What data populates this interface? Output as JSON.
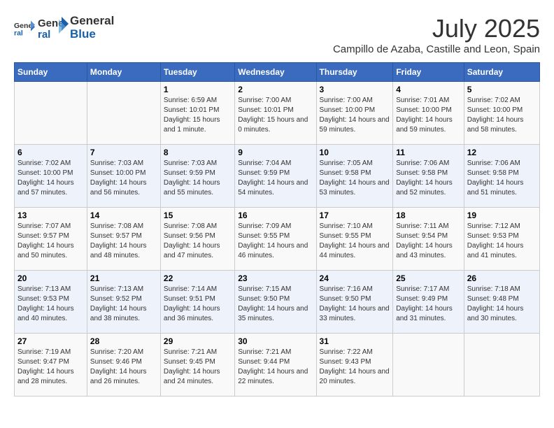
{
  "header": {
    "logo_line1": "General",
    "logo_line2": "Blue",
    "month_year": "July 2025",
    "location": "Campillo de Azaba, Castille and Leon, Spain"
  },
  "weekdays": [
    "Sunday",
    "Monday",
    "Tuesday",
    "Wednesday",
    "Thursday",
    "Friday",
    "Saturday"
  ],
  "weeks": [
    [
      {
        "day": "",
        "sunrise": "",
        "sunset": "",
        "daylight": ""
      },
      {
        "day": "",
        "sunrise": "",
        "sunset": "",
        "daylight": ""
      },
      {
        "day": "1",
        "sunrise": "Sunrise: 6:59 AM",
        "sunset": "Sunset: 10:01 PM",
        "daylight": "Daylight: 15 hours and 1 minute."
      },
      {
        "day": "2",
        "sunrise": "Sunrise: 7:00 AM",
        "sunset": "Sunset: 10:01 PM",
        "daylight": "Daylight: 15 hours and 0 minutes."
      },
      {
        "day": "3",
        "sunrise": "Sunrise: 7:00 AM",
        "sunset": "Sunset: 10:00 PM",
        "daylight": "Daylight: 14 hours and 59 minutes."
      },
      {
        "day": "4",
        "sunrise": "Sunrise: 7:01 AM",
        "sunset": "Sunset: 10:00 PM",
        "daylight": "Daylight: 14 hours and 59 minutes."
      },
      {
        "day": "5",
        "sunrise": "Sunrise: 7:02 AM",
        "sunset": "Sunset: 10:00 PM",
        "daylight": "Daylight: 14 hours and 58 minutes."
      }
    ],
    [
      {
        "day": "6",
        "sunrise": "Sunrise: 7:02 AM",
        "sunset": "Sunset: 10:00 PM",
        "daylight": "Daylight: 14 hours and 57 minutes."
      },
      {
        "day": "7",
        "sunrise": "Sunrise: 7:03 AM",
        "sunset": "Sunset: 10:00 PM",
        "daylight": "Daylight: 14 hours and 56 minutes."
      },
      {
        "day": "8",
        "sunrise": "Sunrise: 7:03 AM",
        "sunset": "Sunset: 9:59 PM",
        "daylight": "Daylight: 14 hours and 55 minutes."
      },
      {
        "day": "9",
        "sunrise": "Sunrise: 7:04 AM",
        "sunset": "Sunset: 9:59 PM",
        "daylight": "Daylight: 14 hours and 54 minutes."
      },
      {
        "day": "10",
        "sunrise": "Sunrise: 7:05 AM",
        "sunset": "Sunset: 9:58 PM",
        "daylight": "Daylight: 14 hours and 53 minutes."
      },
      {
        "day": "11",
        "sunrise": "Sunrise: 7:06 AM",
        "sunset": "Sunset: 9:58 PM",
        "daylight": "Daylight: 14 hours and 52 minutes."
      },
      {
        "day": "12",
        "sunrise": "Sunrise: 7:06 AM",
        "sunset": "Sunset: 9:58 PM",
        "daylight": "Daylight: 14 hours and 51 minutes."
      }
    ],
    [
      {
        "day": "13",
        "sunrise": "Sunrise: 7:07 AM",
        "sunset": "Sunset: 9:57 PM",
        "daylight": "Daylight: 14 hours and 50 minutes."
      },
      {
        "day": "14",
        "sunrise": "Sunrise: 7:08 AM",
        "sunset": "Sunset: 9:57 PM",
        "daylight": "Daylight: 14 hours and 48 minutes."
      },
      {
        "day": "15",
        "sunrise": "Sunrise: 7:08 AM",
        "sunset": "Sunset: 9:56 PM",
        "daylight": "Daylight: 14 hours and 47 minutes."
      },
      {
        "day": "16",
        "sunrise": "Sunrise: 7:09 AM",
        "sunset": "Sunset: 9:55 PM",
        "daylight": "Daylight: 14 hours and 46 minutes."
      },
      {
        "day": "17",
        "sunrise": "Sunrise: 7:10 AM",
        "sunset": "Sunset: 9:55 PM",
        "daylight": "Daylight: 14 hours and 44 minutes."
      },
      {
        "day": "18",
        "sunrise": "Sunrise: 7:11 AM",
        "sunset": "Sunset: 9:54 PM",
        "daylight": "Daylight: 14 hours and 43 minutes."
      },
      {
        "day": "19",
        "sunrise": "Sunrise: 7:12 AM",
        "sunset": "Sunset: 9:53 PM",
        "daylight": "Daylight: 14 hours and 41 minutes."
      }
    ],
    [
      {
        "day": "20",
        "sunrise": "Sunrise: 7:13 AM",
        "sunset": "Sunset: 9:53 PM",
        "daylight": "Daylight: 14 hours and 40 minutes."
      },
      {
        "day": "21",
        "sunrise": "Sunrise: 7:13 AM",
        "sunset": "Sunset: 9:52 PM",
        "daylight": "Daylight: 14 hours and 38 minutes."
      },
      {
        "day": "22",
        "sunrise": "Sunrise: 7:14 AM",
        "sunset": "Sunset: 9:51 PM",
        "daylight": "Daylight: 14 hours and 36 minutes."
      },
      {
        "day": "23",
        "sunrise": "Sunrise: 7:15 AM",
        "sunset": "Sunset: 9:50 PM",
        "daylight": "Daylight: 14 hours and 35 minutes."
      },
      {
        "day": "24",
        "sunrise": "Sunrise: 7:16 AM",
        "sunset": "Sunset: 9:50 PM",
        "daylight": "Daylight: 14 hours and 33 minutes."
      },
      {
        "day": "25",
        "sunrise": "Sunrise: 7:17 AM",
        "sunset": "Sunset: 9:49 PM",
        "daylight": "Daylight: 14 hours and 31 minutes."
      },
      {
        "day": "26",
        "sunrise": "Sunrise: 7:18 AM",
        "sunset": "Sunset: 9:48 PM",
        "daylight": "Daylight: 14 hours and 30 minutes."
      }
    ],
    [
      {
        "day": "27",
        "sunrise": "Sunrise: 7:19 AM",
        "sunset": "Sunset: 9:47 PM",
        "daylight": "Daylight: 14 hours and 28 minutes."
      },
      {
        "day": "28",
        "sunrise": "Sunrise: 7:20 AM",
        "sunset": "Sunset: 9:46 PM",
        "daylight": "Daylight: 14 hours and 26 minutes."
      },
      {
        "day": "29",
        "sunrise": "Sunrise: 7:21 AM",
        "sunset": "Sunset: 9:45 PM",
        "daylight": "Daylight: 14 hours and 24 minutes."
      },
      {
        "day": "30",
        "sunrise": "Sunrise: 7:21 AM",
        "sunset": "Sunset: 9:44 PM",
        "daylight": "Daylight: 14 hours and 22 minutes."
      },
      {
        "day": "31",
        "sunrise": "Sunrise: 7:22 AM",
        "sunset": "Sunset: 9:43 PM",
        "daylight": "Daylight: 14 hours and 20 minutes."
      },
      {
        "day": "",
        "sunrise": "",
        "sunset": "",
        "daylight": ""
      },
      {
        "day": "",
        "sunrise": "",
        "sunset": "",
        "daylight": ""
      }
    ]
  ]
}
